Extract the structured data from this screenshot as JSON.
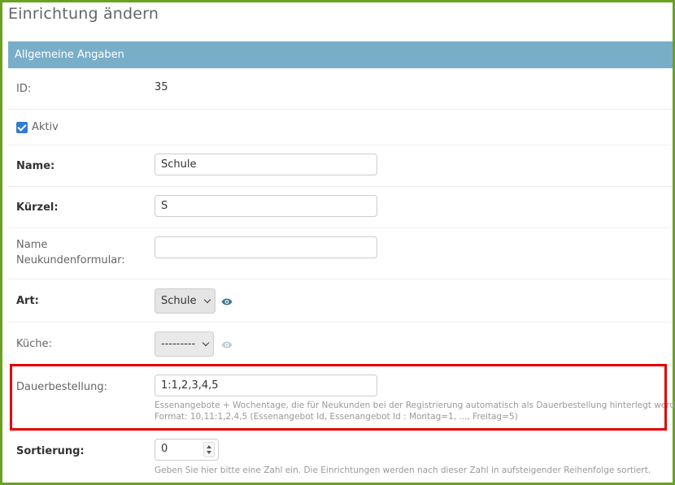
{
  "page_title": "Einrichtung ändern",
  "module_title": "Allgemeine Angaben",
  "colors": {
    "frame_border": "#6aa121",
    "header_bg": "#79aec8",
    "highlight_border": "#e30000",
    "checkbox": "#2f7bd3",
    "eye_icon_active": "#417690"
  },
  "fields": {
    "id": {
      "label": "ID:",
      "value": "35"
    },
    "aktiv": {
      "label": "Aktiv",
      "checked": true
    },
    "name": {
      "label": "Name:",
      "value": "Schule"
    },
    "kuerzel": {
      "label": "Kürzel:",
      "value": "S"
    },
    "name_neukunden": {
      "label_line1": "Name",
      "label_line2": "Neukundenformular:",
      "value": ""
    },
    "art": {
      "label": "Art:",
      "selected": "Schule",
      "icon": "eye-icon"
    },
    "kueche": {
      "label": "Küche:",
      "selected": "---------",
      "icon": "eye-icon"
    },
    "dauerbestellung": {
      "label": "Dauerbestellung:",
      "value": "1:1,2,3,4,5",
      "help_line1": "Essenangebote + Wochentage, die für Neukunden bei der Registrierung automatisch als Dauerbestellung hinterlegt werden.",
      "help_line2": "Format: 10,11:1,2,4,5 (Essenangebot Id, Essenangebot Id : Montag=1, ..., Freitag=5)"
    },
    "sortierung": {
      "label": "Sortierung:",
      "value": "0",
      "help": "Geben Sie hier bitte eine Zahl ein. Die Einrichtungen werden nach dieser Zahl in aufsteigender Reihenfolge sortiert."
    }
  }
}
